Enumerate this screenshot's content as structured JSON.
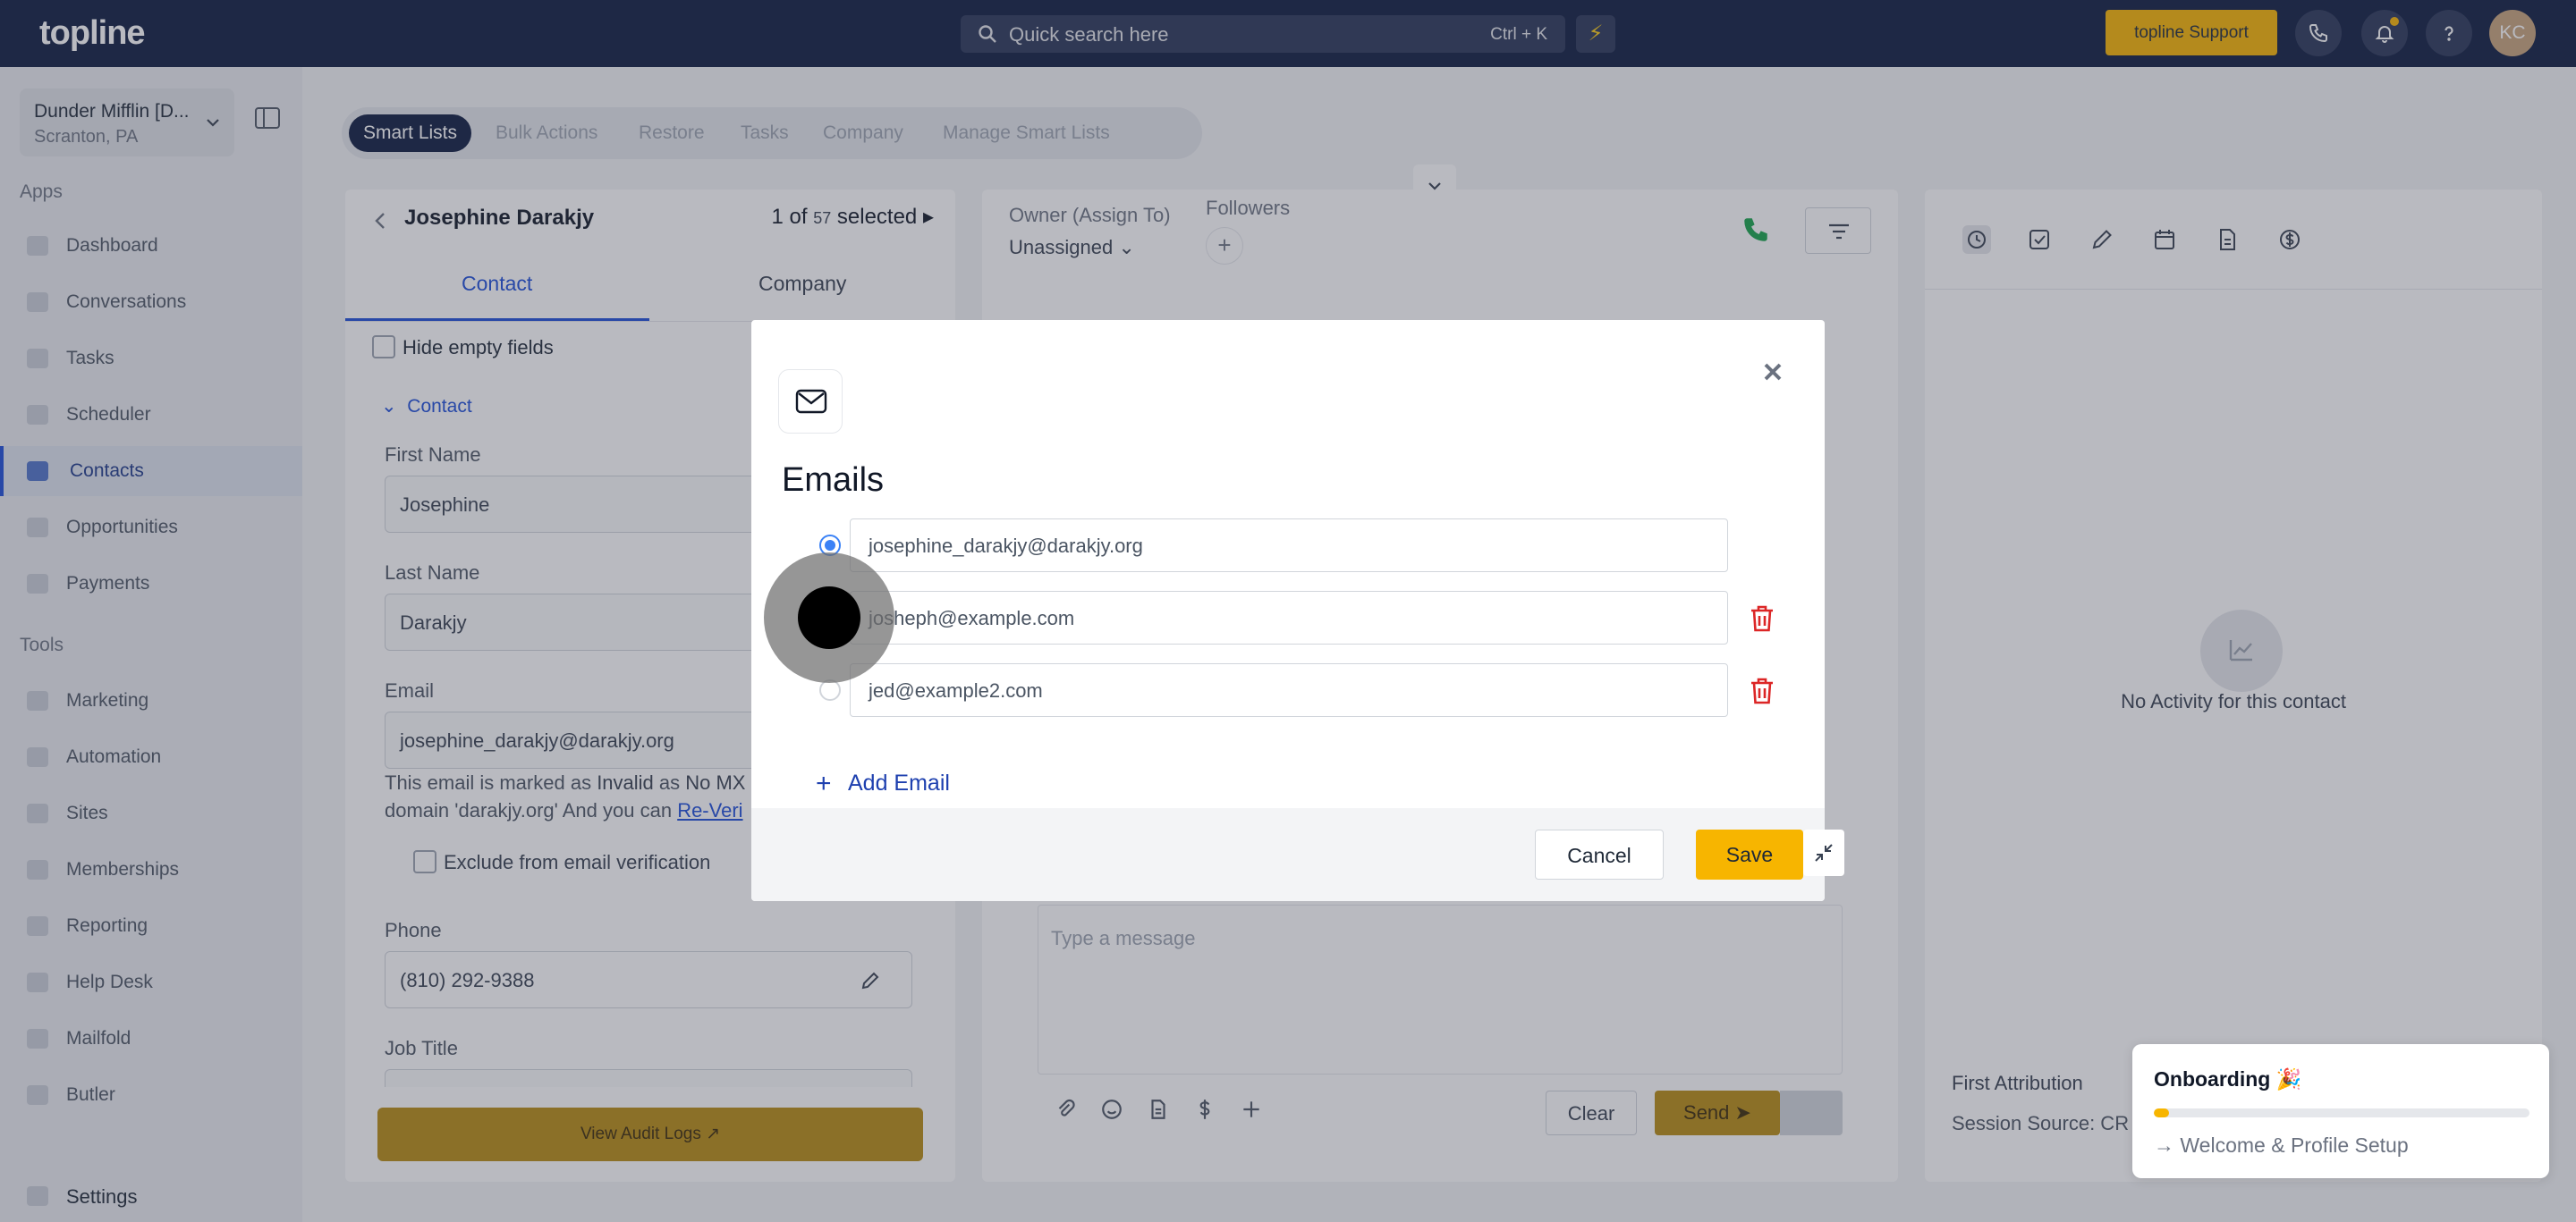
{
  "topbar": {
    "logo": "topline",
    "search_placeholder": "Quick search here",
    "search_shortcut": "Ctrl + K",
    "quick_action_icon": "bolt-icon",
    "support_label": "topline Support",
    "user_initials": "KC"
  },
  "sidebar": {
    "location_name": "Dunder Mifflin [D...",
    "location_city": "Scranton, PA",
    "apps_label": "Apps",
    "apps": [
      {
        "label": "Dashboard",
        "icon": "dashboard-icon"
      },
      {
        "label": "Conversations",
        "icon": "chat-icon"
      },
      {
        "label": "Tasks",
        "icon": "tasks-icon"
      },
      {
        "label": "Scheduler",
        "icon": "calendar-icon"
      },
      {
        "label": "Contacts",
        "icon": "user-icon",
        "active": true
      },
      {
        "label": "Opportunities",
        "icon": "target-icon"
      },
      {
        "label": "Payments",
        "icon": "card-icon"
      }
    ],
    "tools_label": "Tools",
    "tools": [
      {
        "label": "Marketing",
        "icon": "megaphone-icon"
      },
      {
        "label": "Automation",
        "icon": "gears-icon"
      },
      {
        "label": "Sites",
        "icon": "globe-icon"
      },
      {
        "label": "Memberships",
        "icon": "members-icon"
      },
      {
        "label": "Reporting",
        "icon": "pie-icon"
      },
      {
        "label": "Help Desk",
        "icon": "help-icon"
      },
      {
        "label": "Mailfold",
        "icon": "mail-icon"
      },
      {
        "label": "Butler",
        "icon": "bell-icon"
      }
    ],
    "settings_label": "Settings"
  },
  "smart_lists": {
    "tabs": [
      "Smart Lists",
      "Bulk Actions",
      "Restore",
      "Tasks",
      "Company",
      "Manage Smart Lists"
    ]
  },
  "contact_panel": {
    "name": "Josephine Darakjy",
    "count_prefix": "1 of ",
    "count_total": "57",
    "count_suffix": " selected",
    "tabs": [
      "Contact",
      "Company"
    ],
    "hide_empty_label": "Hide empty fields",
    "section_label": "Contact",
    "first_name_label": "First Name",
    "first_name": "Josephine",
    "last_name_label": "Last Name",
    "last_name": "Darakjy",
    "email_label": "Email",
    "email": "josephine_darakjy@darakjy.org",
    "warning_a": "This email is marked as ",
    "warning_b": "Invalid",
    "warning_c": " as ",
    "warning_d": "No MX",
    "warning_e": "domain 'darakjy.org' And you can ",
    "warning_link": "Re-Veri",
    "exclude_label": "Exclude from email verification",
    "phone_label": "Phone",
    "phone": "(810) 292-9388",
    "job_title_label": "Job Title",
    "audit_logs_label": "View Audit Logs"
  },
  "center_panel": {
    "owner_label": "Owner (Assign To)",
    "owner_value": "Unassigned",
    "followers_label": "Followers",
    "message_placeholder": "Type a message",
    "clear_label": "Clear",
    "send_label": "Send"
  },
  "right_panel": {
    "empty_text": "No Activity for this contact",
    "attribution_label": "First Attribution",
    "session_source": "Session Source: CR"
  },
  "modal": {
    "title": "Emails",
    "emails": [
      {
        "value": "josephine_darakjy@darakjy.org",
        "primary": true
      },
      {
        "value": "josheph@example.com",
        "primary": false
      },
      {
        "value": "jed@example2.com",
        "primary": false
      }
    ],
    "add_label": "Add Email",
    "cancel_label": "Cancel",
    "save_label": "Save"
  },
  "onboarding": {
    "title": "Onboarding 🎉",
    "progress": 0.04,
    "step": "Welcome & Profile Setup"
  },
  "colors": {
    "topbar": "#0e1c3f",
    "accent_yellow": "#f7b500",
    "link_blue": "#1d4ed8",
    "danger_red": "#dc2626"
  }
}
